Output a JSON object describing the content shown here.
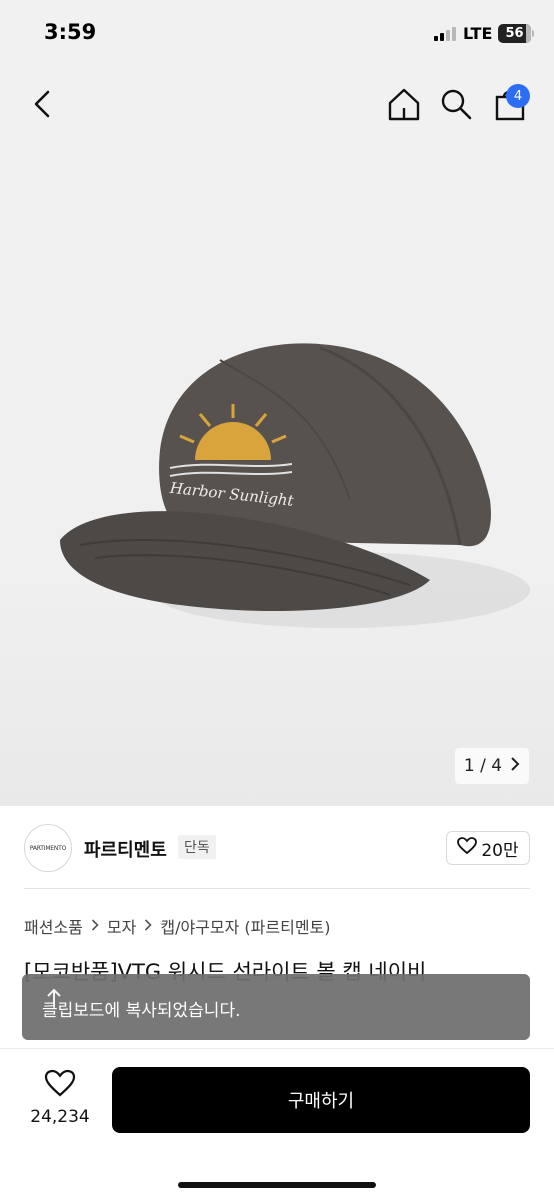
{
  "status_bar": {
    "time": "3:59",
    "network": "LTE",
    "battery": "56"
  },
  "nav": {
    "cart_count": "4",
    "icons": [
      "back-icon",
      "home-icon",
      "search-icon",
      "cart-icon"
    ]
  },
  "gallery": {
    "pager": "1 / 4",
    "cap_text": "Harbor Sunlight"
  },
  "brand": {
    "logo_text": "PARTIMENTO",
    "name": "파르티멘토",
    "tag": "단독",
    "likes": "20만"
  },
  "breadcrumb": {
    "items": [
      "패션소품",
      "모자",
      "캡/야구모자 (파르티멘토)"
    ]
  },
  "product": {
    "title": "[모코반품]VTG 워시드 선라이트 볼 캡 네이비"
  },
  "toast": {
    "message": "클립보드에 복사되었습니다."
  },
  "bottom": {
    "wish_count": "24,234",
    "buy_label": "구매하기"
  },
  "colors": {
    "accent": "#2b6ef5",
    "buy_button": "#000000",
    "toast_bg": "#6e6e6e"
  }
}
